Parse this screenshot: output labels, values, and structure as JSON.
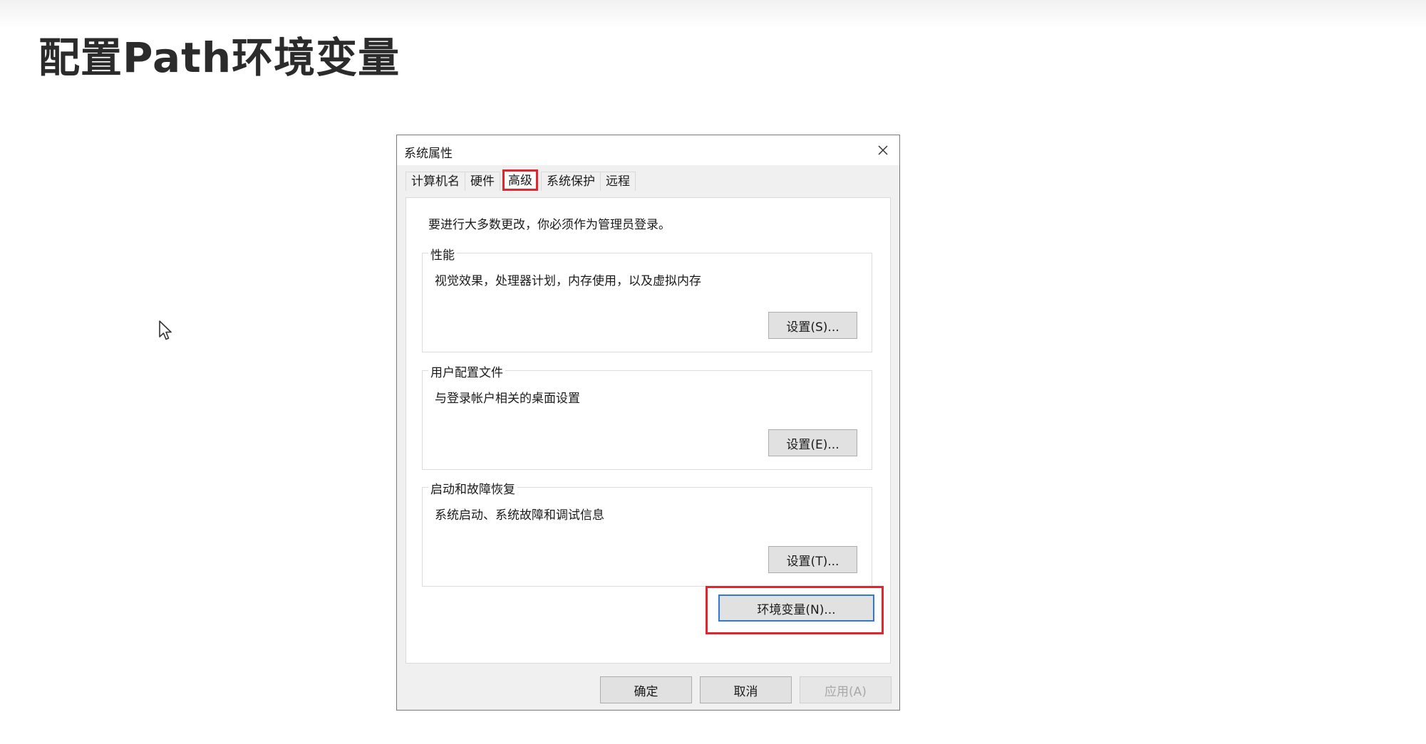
{
  "slide": {
    "title": "配置Path环境变量"
  },
  "dialog": {
    "title": "系统属性",
    "tabs": [
      {
        "label": "计算机名"
      },
      {
        "label": "硬件"
      },
      {
        "label": "高级"
      },
      {
        "label": "系统保护"
      },
      {
        "label": "远程"
      }
    ],
    "active_tab": "高级",
    "admin_note": "要进行大多数更改，你必须作为管理员登录。",
    "groups": [
      {
        "label": "性能",
        "description": "视觉效果，处理器计划，内存使用，以及虚拟内存",
        "button": "设置(S)..."
      },
      {
        "label": "用户配置文件",
        "description": "与登录帐户相关的桌面设置",
        "button": "设置(E)..."
      },
      {
        "label": "启动和故障恢复",
        "description": "系统启动、系统故障和调试信息",
        "button": "设置(T)..."
      }
    ],
    "env_button": "环境变量(N)...",
    "footer": {
      "ok": "确定",
      "cancel": "取消",
      "apply": "应用(A)"
    }
  },
  "colors": {
    "highlight": "#e3262d",
    "focus": "#2f7ad6"
  },
  "icons": {
    "close": "close-icon",
    "cursor": "mouse-cursor-icon"
  }
}
